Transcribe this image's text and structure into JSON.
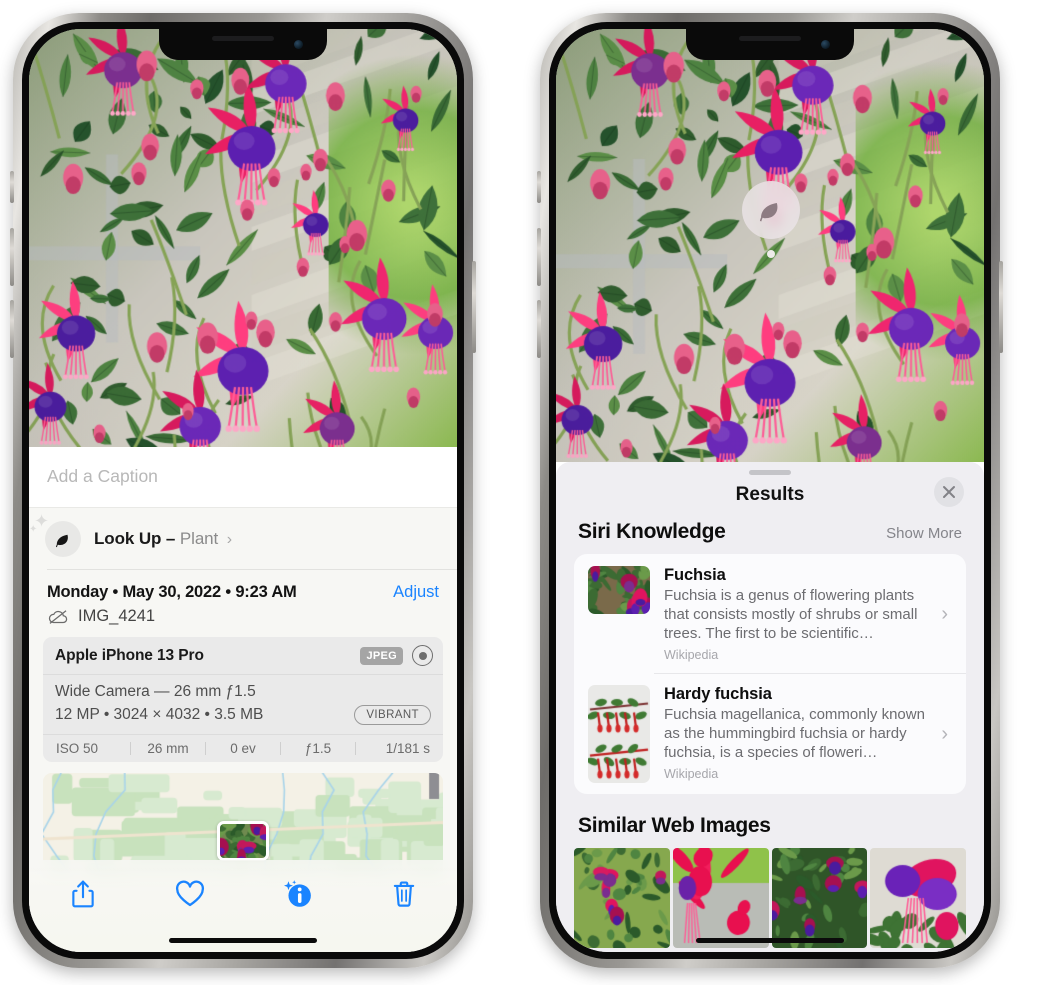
{
  "left_phone": {
    "caption_placeholder": "Add a Caption",
    "lookup": {
      "label": "Look Up –",
      "subject": "Plant",
      "chevron": "›",
      "icon": "leaf-icon"
    },
    "date_line": "Monday • May 30, 2022 • 9:23 AM",
    "adjust_label": "Adjust",
    "file_name": "IMG_4241",
    "cloud_icon": "icloud-slash-icon",
    "camera_card": {
      "model": "Apple iPhone 13 Pro",
      "format_tag": "JPEG",
      "raw_icon": "aperture-icon",
      "lens_line": "Wide Camera — 26 mm ƒ1.5",
      "spec_line": "12 MP • 3024 × 4032 • 3.5 MB",
      "style_pill": "VIBRANT",
      "exif": [
        "ISO 50",
        "26 mm",
        "0 ev",
        "ƒ1.5",
        "1/181 s"
      ]
    },
    "toolbar": {
      "share_label": "share-icon",
      "favorite_label": "heart-icon",
      "info_label": "info-sparkle-icon",
      "delete_label": "trash-icon",
      "accent": "#1a84ff"
    }
  },
  "right_phone": {
    "badge": {
      "icon": "leaf-icon",
      "name": "visual-look-up-badge"
    },
    "sheet": {
      "title": "Results",
      "close_icon": "close-icon"
    },
    "siri_knowledge": {
      "heading": "Siri Knowledge",
      "show_more": "Show More",
      "items": [
        {
          "title": "Fuchsia",
          "description": "Fuchsia is a genus of flowering plants that consists mostly of shrubs or small trees. The first to be scientific…",
          "source": "Wikipedia",
          "chevron": "›"
        },
        {
          "title": "Hardy fuchsia",
          "description": "Fuchsia magellanica, commonly known as the hummingbird fuchsia or hardy fuchsia, is a species of floweri…",
          "source": "Wikipedia",
          "chevron": "›"
        }
      ]
    },
    "similar_web_images": {
      "heading": "Similar Web Images",
      "count": 4
    }
  }
}
